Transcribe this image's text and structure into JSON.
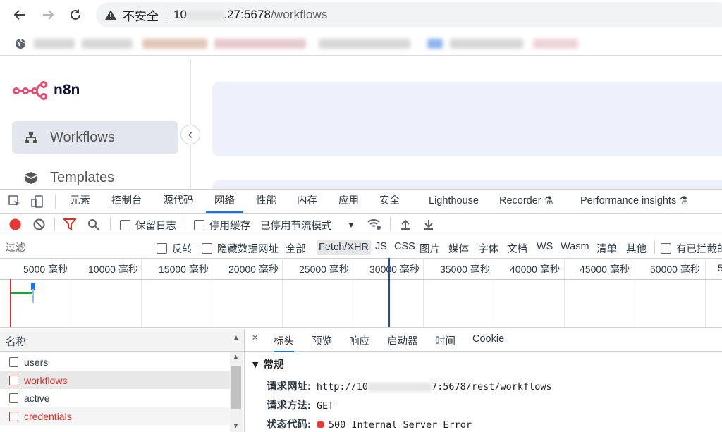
{
  "browser": {
    "insecure_label": "不安全",
    "url_host_prefix": "10",
    "url_host_suffix": ".27:5678",
    "url_path": "/workflows",
    "colors": {
      "omnibox": "#f1f3f4"
    }
  },
  "sidebar": {
    "logo_text": "n8n",
    "items": [
      {
        "label": "Workflows",
        "icon": "sitemap-icon",
        "active": true
      },
      {
        "label": "Templates",
        "icon": "box-icon",
        "active": false
      }
    ],
    "collapse_glyph": "‹"
  },
  "devtools": {
    "tabs": [
      "元素",
      "控制台",
      "源代码",
      "网络",
      "性能",
      "内存",
      "应用",
      "安全",
      "Lighthouse",
      "Recorder ⚗",
      "Performance insights ⚗"
    ],
    "active_tab": "网络",
    "toolbar": {
      "preserve_log": "保留日志",
      "disable_cache": "停用缓存",
      "throttling": "已停用节流模式",
      "throttling_arrow": "▼"
    },
    "filter": {
      "placeholder": "过滤",
      "invert": "反转",
      "hide_data_urls": "隐藏数据网址",
      "types": [
        "全部",
        "Fetch/XHR",
        "JS",
        "CSS",
        "图片",
        "媒体",
        "字体",
        "文档",
        "WS",
        "Wasm",
        "清单",
        "其他"
      ],
      "active_type": "Fetch/XHR",
      "blocked": "有已拦截的"
    },
    "timeline_ticks": [
      "5000 毫秒",
      "10000 毫秒",
      "15000 毫秒",
      "20000 毫秒",
      "25000 毫秒",
      "30000 毫秒",
      "35000 毫秒",
      "40000 毫秒",
      "45000 毫秒",
      "50000 毫秒",
      "5"
    ],
    "request_list": {
      "header": "名称",
      "sort_glyph": "▲",
      "rows": [
        {
          "name": "users",
          "error": false
        },
        {
          "name": "workflows",
          "error": true
        },
        {
          "name": "active",
          "error": false
        },
        {
          "name": "credentials",
          "error": true
        }
      ]
    },
    "detail": {
      "close_glyph": "×",
      "tabs": [
        "标头",
        "预览",
        "响应",
        "启动器",
        "时间",
        "Cookie"
      ],
      "active_tab": "标头",
      "section": "▼ 常规",
      "request_url_key": "请求网址:",
      "request_url_prefix": "http://10",
      "request_url_suffix": "7:5678/rest/workflows",
      "request_method_key": "请求方法:",
      "request_method": "GET",
      "status_key": "状态代码:",
      "status_value": "500 Internal Server Error"
    }
  }
}
